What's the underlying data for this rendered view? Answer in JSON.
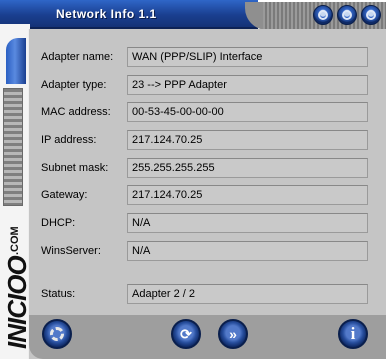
{
  "window": {
    "title": "Network Info 1.1"
  },
  "brand": {
    "logo": "INICIOO",
    "suffix": ".COM"
  },
  "fields": [
    {
      "label": "Adapter name:",
      "value": "WAN (PPP/SLIP) Interface"
    },
    {
      "label": "Adapter type:",
      "value": "23  -->  PPP Adapter"
    },
    {
      "label": "MAC address:",
      "value": "00-53-45-00-00-00"
    },
    {
      "label": "IP address:",
      "value": "217.124.70.25"
    },
    {
      "label": "Subnet mask:",
      "value": "255.255.255.255"
    },
    {
      "label": "Gateway:",
      "value": "217.124.70.25"
    },
    {
      "label": "DHCP:",
      "value": "N/A"
    },
    {
      "label": "WinsServer:",
      "value": "N/A"
    }
  ],
  "status": {
    "label": "Status:",
    "value": "Adapter 2 / 2"
  },
  "buttons": {
    "refresh_glyph": "⟳",
    "next_glyph": "»",
    "info_glyph": "i"
  },
  "colors": {
    "title_bar": "#1a3f90",
    "panel": "#c5c5c5",
    "button": "#284f9e"
  }
}
